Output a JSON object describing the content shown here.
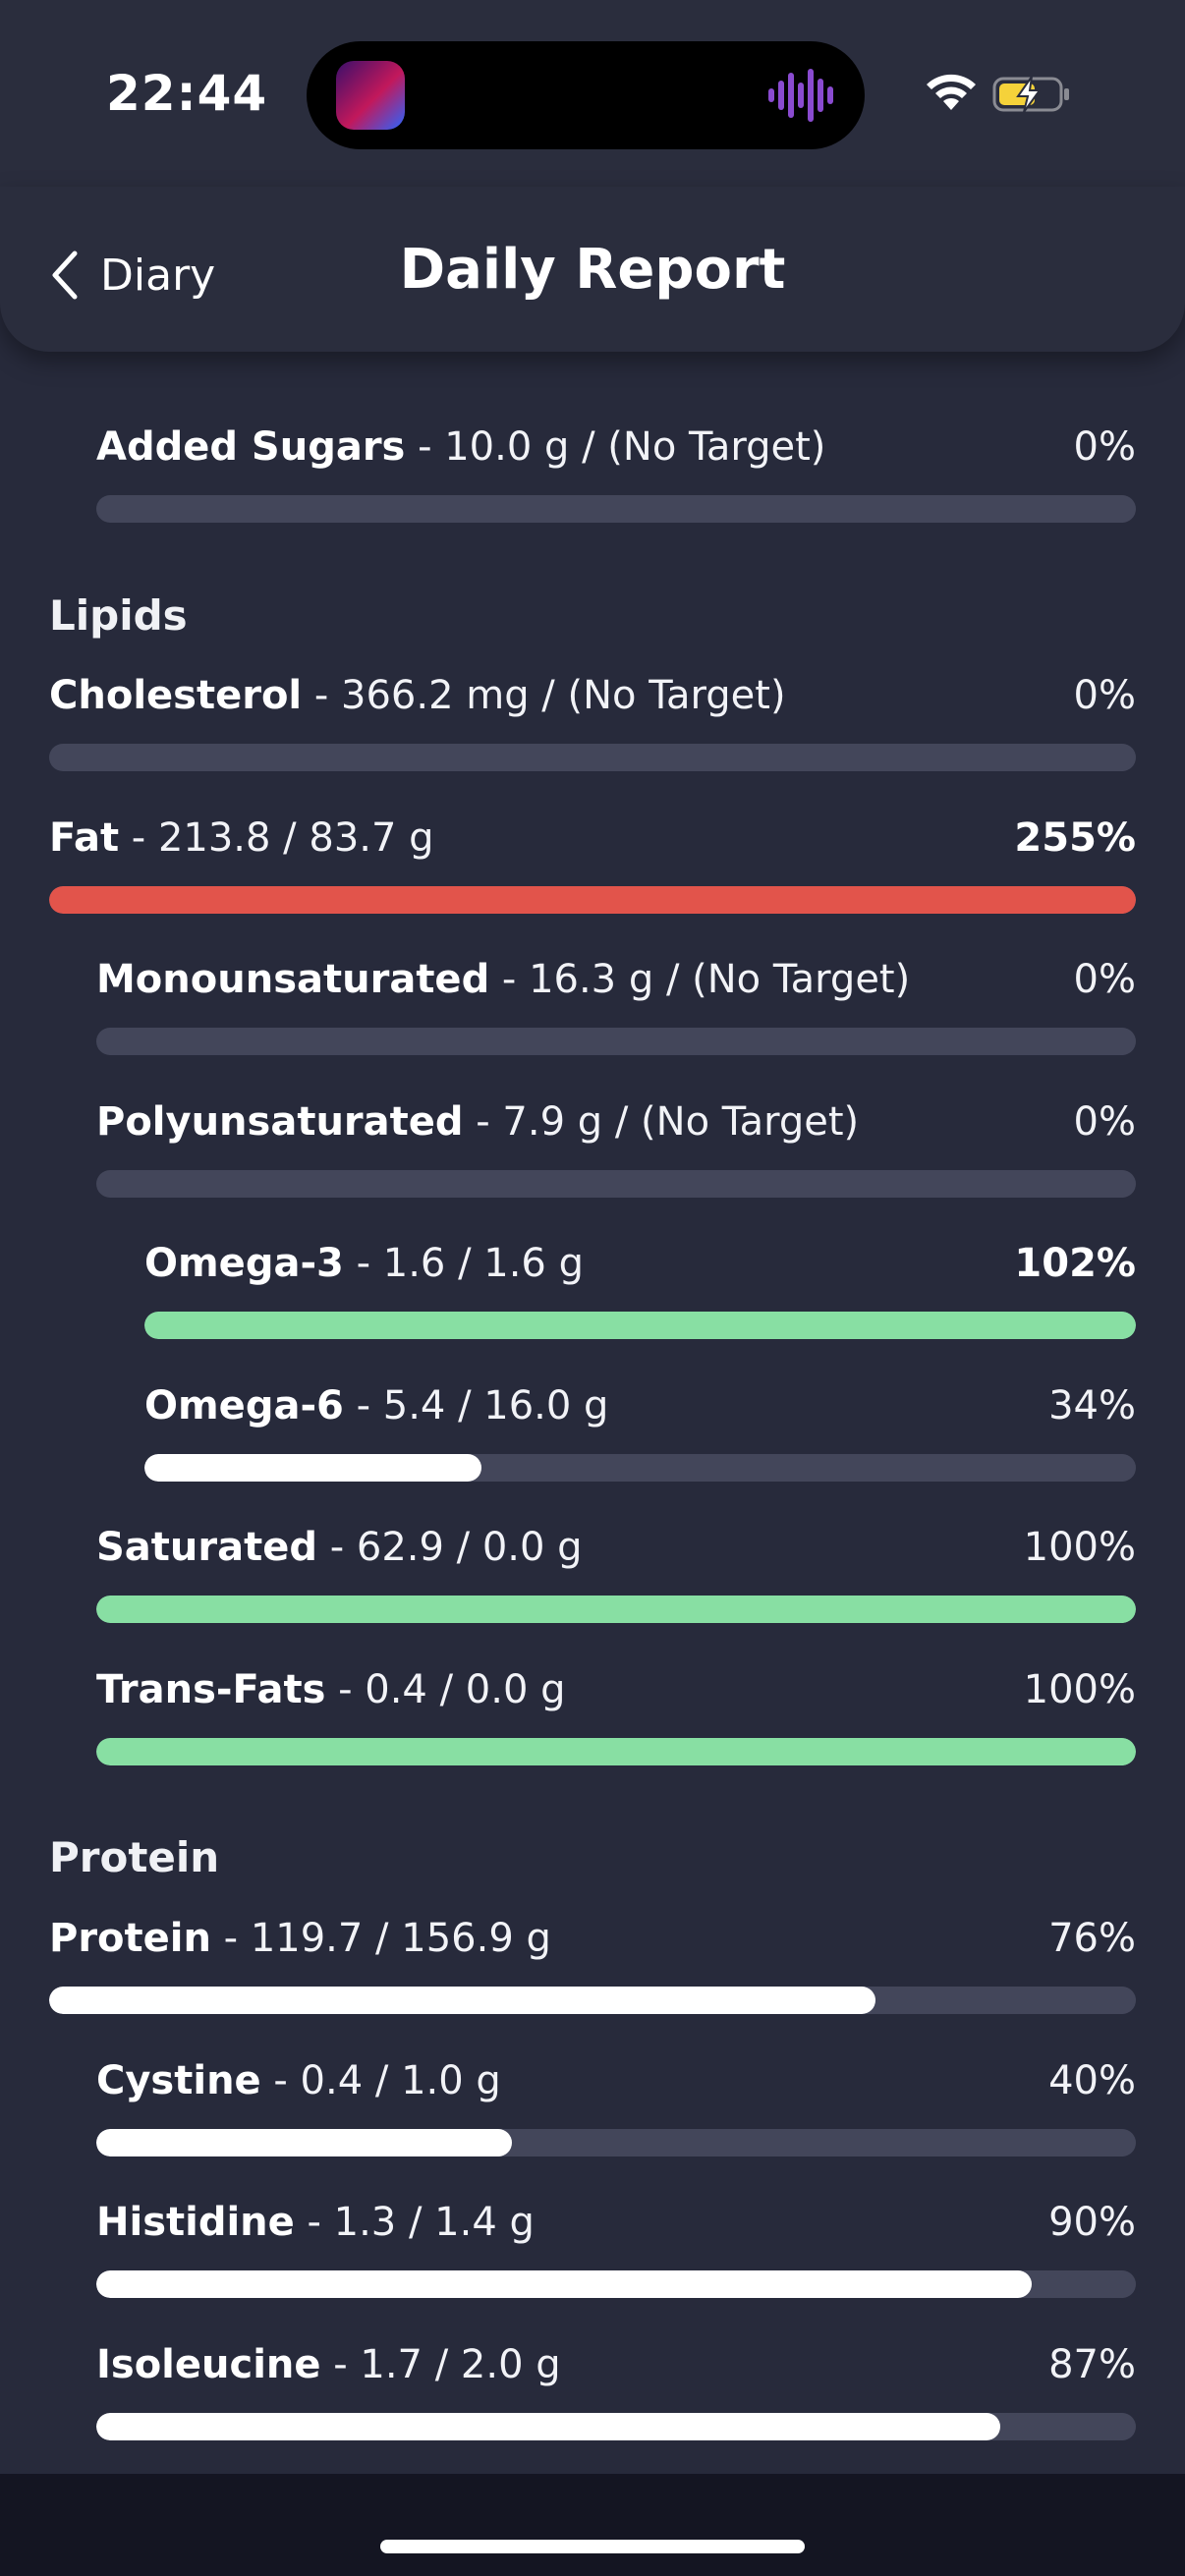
{
  "status_bar": {
    "time": "22:44"
  },
  "nav": {
    "back_label": "Diary",
    "title": "Daily Report"
  },
  "sections": {
    "lipids": "Lipids",
    "protein": "Protein"
  },
  "rows": [
    {
      "name": "",
      "detail": "",
      "percent": "",
      "fill": 0.0,
      "color": "none"
    },
    {
      "name": "Added Sugars",
      "detail": " - 10.0 g / (No Target)",
      "percent": "0%",
      "fill": 0.0,
      "color": "white"
    },
    {
      "name": "Cholesterol",
      "detail": " - 366.2 mg / (No Target)",
      "percent": "0%",
      "fill": 0.0,
      "color": "white"
    },
    {
      "name": "Fat",
      "detail": " - 213.8 / 83.7 g",
      "percent": "255%",
      "fill": 1.0,
      "color": "red"
    },
    {
      "name": "Monounsaturated",
      "detail": " - 16.3 g / (No Target)",
      "percent": "0%",
      "fill": 0.0,
      "color": "white"
    },
    {
      "name": "Polyunsaturated",
      "detail": " - 7.9 g / (No Target)",
      "percent": "0%",
      "fill": 0.0,
      "color": "white"
    },
    {
      "name": "Omega-3",
      "detail": " - 1.6 / 1.6 g",
      "percent": "102%",
      "fill": 1.0,
      "color": "green"
    },
    {
      "name": "Omega-6",
      "detail": " - 5.4 / 16.0 g",
      "percent": "34%",
      "fill": 0.34,
      "color": "white"
    },
    {
      "name": "Saturated",
      "detail": " - 62.9 / 0.0 g",
      "percent": "100%",
      "fill": 1.0,
      "color": "green"
    },
    {
      "name": "Trans-Fats",
      "detail": " - 0.4 / 0.0 g",
      "percent": "100%",
      "fill": 1.0,
      "color": "green"
    },
    {
      "name": "Protein",
      "detail": " - 119.7 / 156.9 g",
      "percent": "76%",
      "fill": 0.76,
      "color": "white"
    },
    {
      "name": "Cystine",
      "detail": " - 0.4 / 1.0 g",
      "percent": "40%",
      "fill": 0.4,
      "color": "white"
    },
    {
      "name": "Histidine",
      "detail": " - 1.3 / 1.4 g",
      "percent": "90%",
      "fill": 0.9,
      "color": "white"
    },
    {
      "name": "Isoleucine",
      "detail": " - 1.7 / 2.0 g",
      "percent": "87%",
      "fill": 0.87,
      "color": "white"
    }
  ],
  "colors": {
    "background": "#272a3b",
    "track": "#43465a",
    "green": "#88dfa3",
    "red": "#e2544b"
  }
}
